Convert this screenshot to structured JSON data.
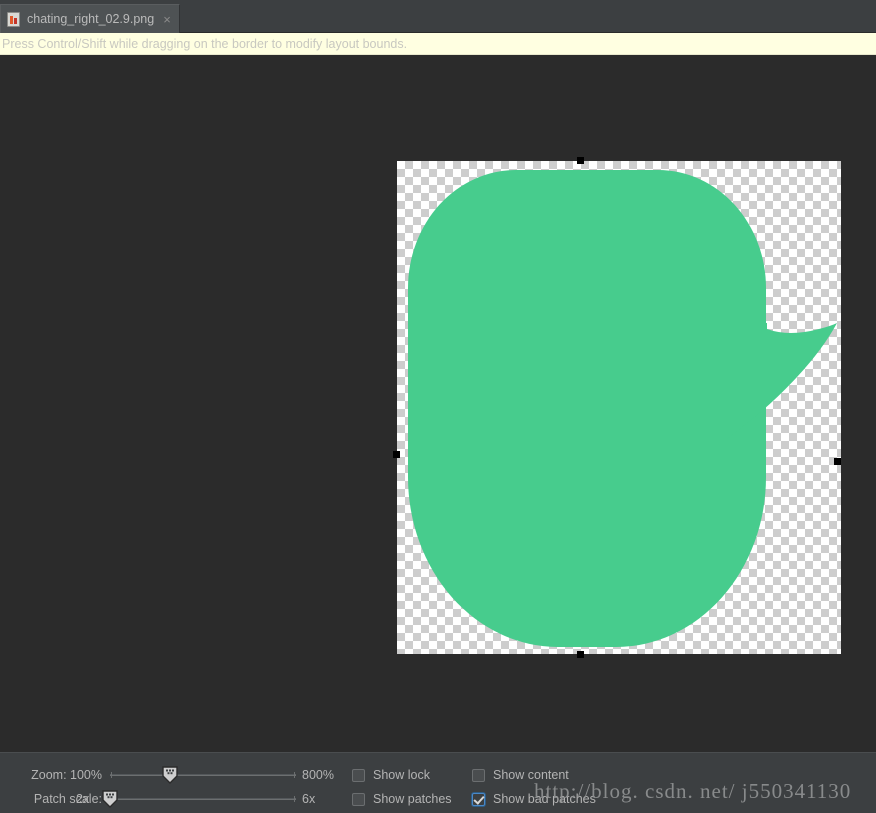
{
  "window": {
    "background_color": "#2b2b2b"
  },
  "tab": {
    "title": "chating_right_02.9.png",
    "close_label": "×",
    "icon": "nine-patch-file-icon"
  },
  "notice": {
    "text": "Press Control/Shift while dragging on the border to modify layout bounds.",
    "background_color": "#ffffe1"
  },
  "canvas": {
    "image_name": "chating_right_02.9.png",
    "shape": "chat-bubble",
    "bubble_color": "#47cc8d",
    "transparency": "checkerboard",
    "handles": [
      "top",
      "right",
      "bottom",
      "left"
    ]
  },
  "controls": {
    "zoom": {
      "label": "Zoom: 100%",
      "value": "100%",
      "max_label": "800%",
      "thumb_percent": 33
    },
    "patch_scale": {
      "label": "Patch scale:",
      "value": "2x",
      "min_label": "2x",
      "max_label": "6x",
      "thumb_percent": 0
    },
    "checkboxes": [
      {
        "label": "Show lock",
        "checked": false
      },
      {
        "label": "Show content",
        "checked": false
      },
      {
        "label": "Show patches",
        "checked": false
      },
      {
        "label": "Show bad patches",
        "checked": true
      }
    ]
  },
  "watermark": {
    "text": "http://blog. csdn. net/ j550341130"
  }
}
